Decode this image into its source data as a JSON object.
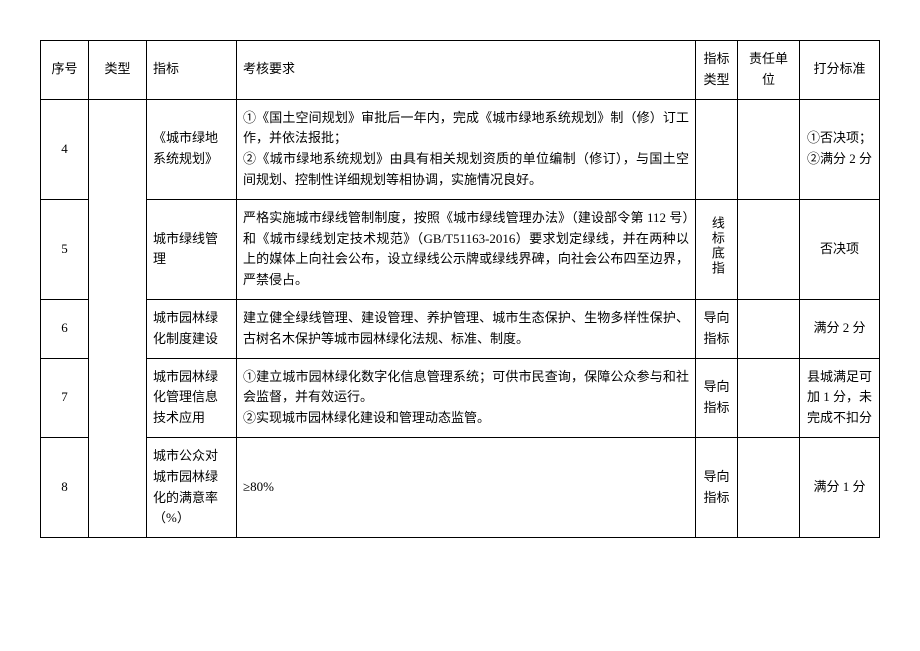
{
  "headers": {
    "seq": "序号",
    "type": "类型",
    "indicator": "指标",
    "requirement": "考核要求",
    "ind_type": "指标类型",
    "unit": "责任单位",
    "score": "打分标准"
  },
  "rows": [
    {
      "seq": "4",
      "indicator": "《城市绿地系统规划》",
      "requirement": "①《国土空间规划》审批后一年内，完成《城市绿地系统规划》制（修）订工作，并依法报批；\n②《城市绿地系统规划》由具有相关规划资质的单位编制（修订），与国土空间规划、控制性详细规划等相协调，实施情况良好。",
      "ind_type": "",
      "unit": "",
      "score": "①否决项；\n②满分 2 分"
    },
    {
      "seq": "5",
      "indicator": "城市绿线管理",
      "requirement": "严格实施城市绿线管制制度，按照《城市绿线管理办法》（建设部令第 112 号）和《城市绿线划定技术规范》（GB/T51163-2016）要求划定绿线，并在两种以上的媒体上向社会公布，设立绿线公示牌或绿线界碑，向社会公布四至边界，严禁侵占。",
      "ind_type": "线标底指",
      "unit": "",
      "score": "否决项"
    },
    {
      "seq": "6",
      "indicator": "城市园林绿化制度建设",
      "requirement": "建立健全绿线管理、建设管理、养护管理、城市生态保护、生物多样性保护、古树名木保护等城市园林绿化法规、标准、制度。",
      "ind_type": "导向指标",
      "unit": "",
      "score": "满分 2 分"
    },
    {
      "seq": "7",
      "indicator": "城市园林绿化管理信息技术应用",
      "requirement": "①建立城市园林绿化数字化信息管理系统；可供市民查询，保障公众参与和社会监督，并有效运行。\n②实现城市园林绿化建设和管理动态监管。",
      "ind_type": "导向指标",
      "unit": "",
      "score": "县城满足可加 1 分，未完成不扣分"
    },
    {
      "seq": "8",
      "indicator": "城市公众对城市园林绿化的满意率（%）",
      "requirement": "≥80%",
      "ind_type": "导向指标",
      "unit": "",
      "score": "满分 1 分"
    }
  ]
}
